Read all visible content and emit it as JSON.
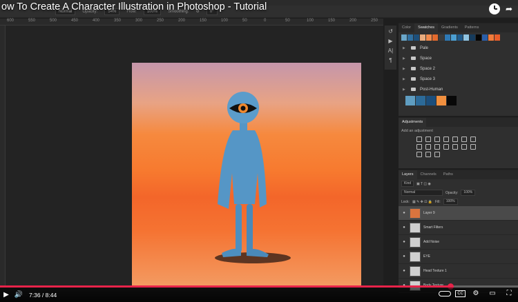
{
  "video": {
    "title": "ow To Create A Character Illustration in Photoshop - Tutorial",
    "current_time": "7:36",
    "duration": "8:44",
    "time_separator": " / ",
    "progress_fraction": 0.87
  },
  "options_bar": {
    "mode": "Normal",
    "opacity_label": "Opacity:",
    "opacity_value": "54%",
    "flow_label": "Flow:",
    "flow_value": "100%",
    "smoothing_label": "Smoothing:",
    "angle_value": "0°"
  },
  "ruler": {
    "ticks": [
      "600",
      "550",
      "500",
      "450",
      "400",
      "350",
      "300",
      "250",
      "200",
      "150",
      "100",
      "50",
      "0",
      "50",
      "100",
      "150",
      "200",
      "250"
    ]
  },
  "swatches_panel": {
    "tabs": [
      "Color",
      "Swatches",
      "Gradients",
      "Patterns"
    ],
    "active_tab": "Swatches",
    "top_colors": [
      "#6aa6c9",
      "#2f6fa0",
      "#1d4f7a",
      "#e9ac7e",
      "#f28a4c",
      "#e36a2d",
      "#3b3b3b",
      "#2e79b5",
      "#4c9fd2",
      "#1f5b8c",
      "#8fc4e2",
      "#163b5c",
      "#050505",
      "#2a5ea8",
      "#f27b3b",
      "#e95d2a"
    ],
    "groups": [
      "Pale",
      "Space",
      "Space 2",
      "Space 3",
      "Post-Human"
    ],
    "post_human_colors": [
      "#5f9dc1",
      "#2c6a98",
      "#1c4e7b",
      "#f1903f",
      "#080808"
    ]
  },
  "adjustments_panel": {
    "title": "Adjustments",
    "add_label": "Add an adjustment"
  },
  "layers_panel": {
    "tabs": [
      "Layers",
      "Channels",
      "Paths"
    ],
    "active_tab": "Layers",
    "filter": "Kind",
    "blend_mode": "Normal",
    "opacity_label": "Opacity:",
    "opacity_value": "100%",
    "lock_label": "Lock:",
    "fill_label": "Fill:",
    "fill_value": "100%",
    "layers": [
      {
        "name": "Layer 9",
        "selected": true
      },
      {
        "name": "Smart Filters",
        "selected": false
      },
      {
        "name": "Add Noise",
        "selected": false
      },
      {
        "name": "EYE",
        "selected": false
      },
      {
        "name": "Head Texture 1",
        "selected": false
      },
      {
        "name": "Body Texture",
        "selected": false
      }
    ]
  },
  "colors": {
    "progress_red": "#e8234a",
    "panel_bg": "#2f2f2f",
    "character_blue": "#4d8fc0"
  }
}
